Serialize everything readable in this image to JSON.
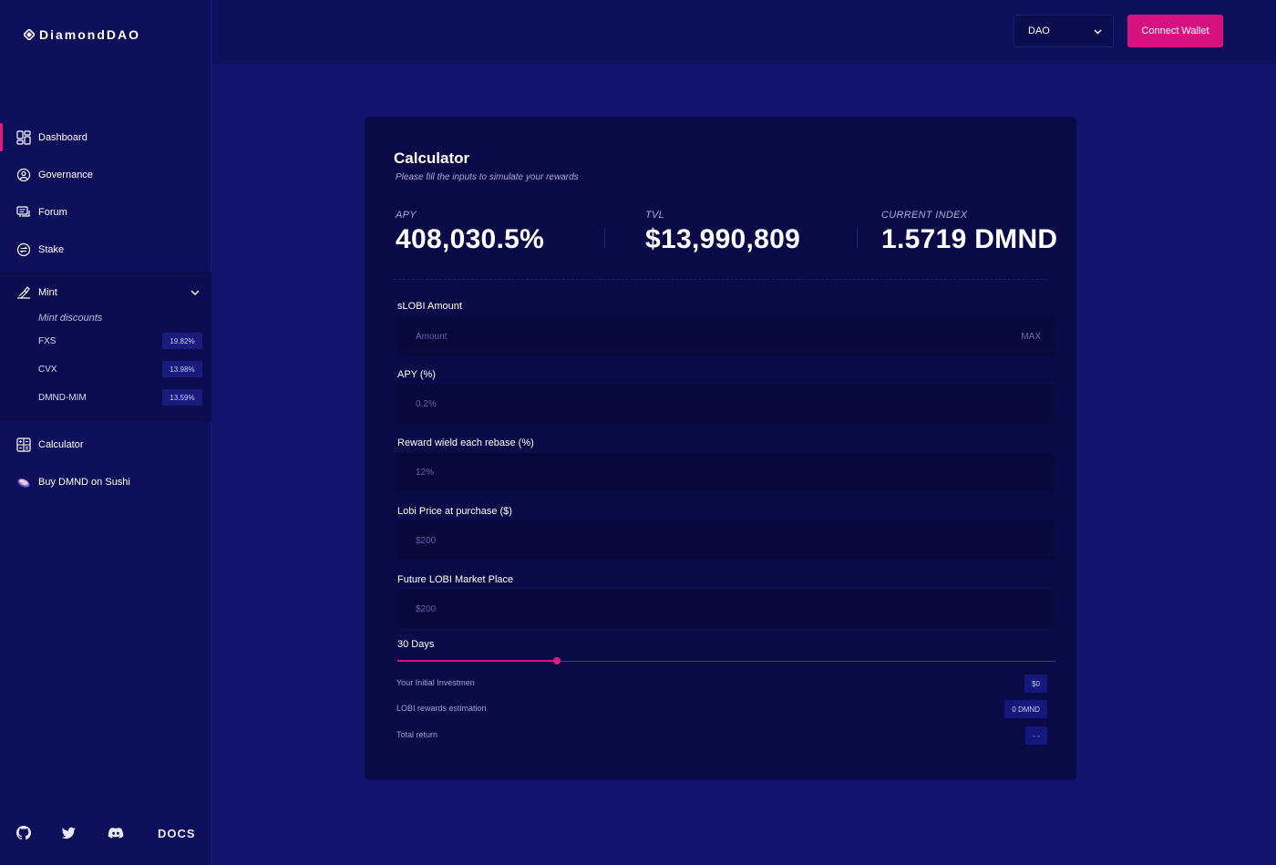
{
  "brand": {
    "name": "DiamondDAO"
  },
  "sidebar": {
    "items": [
      {
        "label": "Dashboard",
        "icon": "dashboard-icon",
        "active": true
      },
      {
        "label": "Governance",
        "icon": "governance-icon"
      },
      {
        "label": "Forum",
        "icon": "forum-icon"
      },
      {
        "label": "Stake",
        "icon": "stake-icon"
      }
    ],
    "mint": {
      "label": "Mint",
      "icon": "mint-icon",
      "subtitle": "Mint discounts",
      "discounts": [
        {
          "name": "FXS",
          "value": "19.82%"
        },
        {
          "name": "CVX",
          "value": "13.98%"
        },
        {
          "name": "DMND-MIM",
          "value": "13.59%"
        }
      ]
    },
    "items2": [
      {
        "label": "Calculator",
        "icon": "calculator-icon"
      },
      {
        "label": "Buy DMND on Sushi",
        "icon": "sushi-icon"
      }
    ],
    "footer": {
      "docs": "DOCS"
    }
  },
  "topbar": {
    "dao_select": "DAO",
    "connect": "Connect Wallet"
  },
  "calculator": {
    "title": "Calculator",
    "subtitle": "Please fill the inputs to simulate your rewards",
    "stats": [
      {
        "label": "APY",
        "value": "408,030.5%"
      },
      {
        "label": "TVL",
        "value": "$13,990,809"
      },
      {
        "label": "CURRENT INDEX",
        "value": "1.5719 DMND"
      }
    ],
    "fields": [
      {
        "label": "sLOBI Amount",
        "placeholder": "Amount",
        "suffix": "MAX"
      },
      {
        "label": "APY (%)",
        "placeholder": "0.2%"
      },
      {
        "label": "Reward wield each rebase (%)",
        "placeholder": "12%"
      },
      {
        "label": "Lobi Price at purchase ($)",
        "placeholder": "$200"
      },
      {
        "label": "Future LOBI Market Place",
        "placeholder": "$200"
      }
    ],
    "days": {
      "label": "30 Days",
      "fraction": 0.24
    },
    "results": [
      {
        "label": "Your Initial Investmen",
        "value": "$0"
      },
      {
        "label": "LOBI rewards estimation",
        "value": "0 DMND"
      },
      {
        "label": "Total return",
        "value": "- -"
      }
    ]
  },
  "colors": {
    "accent": "#d5127f",
    "background": "#11126b",
    "card": "#0a0a47",
    "sidebar": "#0e0f5a"
  }
}
